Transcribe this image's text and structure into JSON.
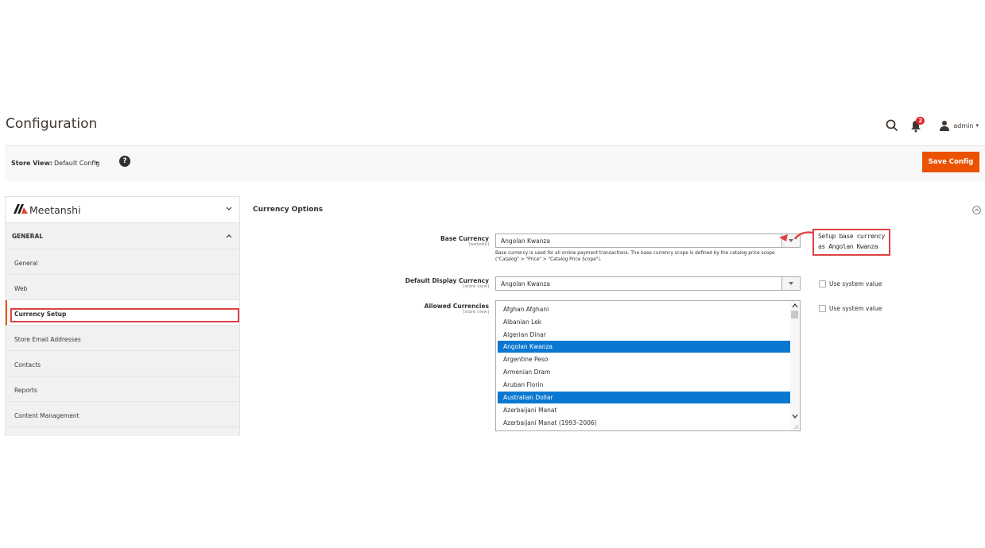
{
  "header": {
    "title": "Configuration",
    "notifications_count": "2",
    "user": "admin"
  },
  "store_bar": {
    "label": "Store View:",
    "value": "Default Config",
    "help": "?",
    "save_button": "Save Config"
  },
  "sidebar": {
    "brand": "Meetanshi",
    "section": "GENERAL",
    "items": [
      {
        "label": "General",
        "active": false
      },
      {
        "label": "Web",
        "active": false
      },
      {
        "label": "Currency Setup",
        "active": true
      },
      {
        "label": "Store Email Addresses",
        "active": false
      },
      {
        "label": "Contacts",
        "active": false
      },
      {
        "label": "Reports",
        "active": false
      },
      {
        "label": "Content Management",
        "active": false
      }
    ]
  },
  "main": {
    "section_title": "Currency Options",
    "base_currency": {
      "label": "Base Currency",
      "scope": "[website]",
      "value": "Angolan Kwanza",
      "note_line1": "Base currency is used for all online payment transactions. The base currency scope is defined by the catalog price scope",
      "note_line2": "(\"Catalog\" > \"Price\" > \"Catalog Price Scope\")."
    },
    "default_display": {
      "label": "Default Display Currency",
      "scope": "[store view]",
      "value": "Angolan Kwanza",
      "system_label": "Use system value"
    },
    "allowed": {
      "label": "Allowed Currencies",
      "scope": "[store view]",
      "system_label": "Use system value",
      "options": [
        {
          "label": "Afghan Afghani",
          "selected": false
        },
        {
          "label": "Albanian Lek",
          "selected": false
        },
        {
          "label": "Algerian Dinar",
          "selected": false
        },
        {
          "label": "Angolan Kwanza",
          "selected": true
        },
        {
          "label": "Argentine Peso",
          "selected": false
        },
        {
          "label": "Armenian Dram",
          "selected": false
        },
        {
          "label": "Aruban Florin",
          "selected": false
        },
        {
          "label": "Australian Dollar",
          "selected": true
        },
        {
          "label": "Azerbaijani Manat",
          "selected": false
        },
        {
          "label": "Azerbaijani Manat (1993–2006)",
          "selected": false
        }
      ]
    }
  },
  "callout": {
    "line1": "Setup base currency",
    "line2": "as Angolan Kwanza"
  },
  "colors": {
    "accent": "#eb5202",
    "selection": "#0a78d1",
    "annotation": "#e04145"
  }
}
